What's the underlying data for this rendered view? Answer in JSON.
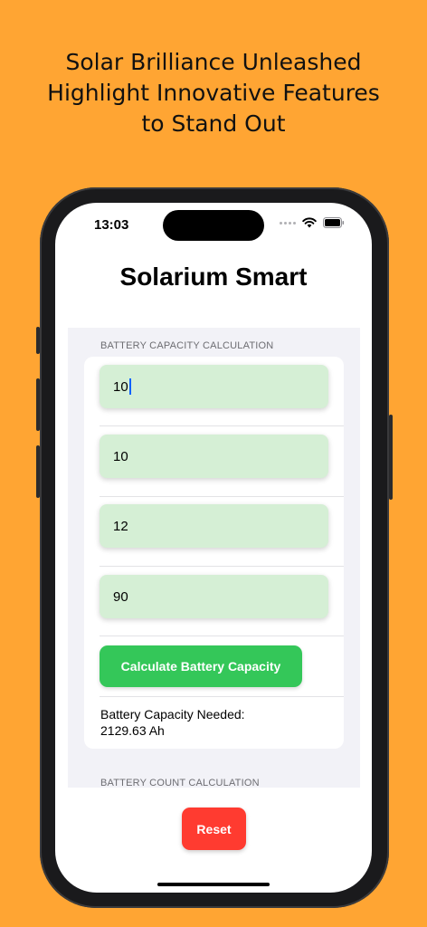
{
  "promo": {
    "line1": "Solar Brilliance Unleashed",
    "line2": "Highlight Innovative Features",
    "line3": "to Stand Out"
  },
  "status_bar": {
    "time": "13:03",
    "icons": [
      "signal-dots-icon",
      "wifi-icon",
      "battery-icon"
    ]
  },
  "app": {
    "title": "Solarium Smart",
    "battery_capacity": {
      "header": "BATTERY CAPACITY CALCULATION",
      "inputs": [
        {
          "value": "10"
        },
        {
          "value": "10"
        },
        {
          "value": "12"
        },
        {
          "value": "90"
        }
      ],
      "calculate_label": "Calculate Battery Capacity",
      "result_label": "Battery Capacity Needed:",
      "result_value": "2129.63 Ah"
    },
    "battery_count": {
      "header": "BATTERY COUNT CALCULATION"
    },
    "reset_label": "Reset"
  },
  "colors": {
    "background": "#FFA533",
    "input_fill": "#D5EFD5",
    "calculate_button": "#34C759",
    "reset_button": "#FF3B30"
  }
}
